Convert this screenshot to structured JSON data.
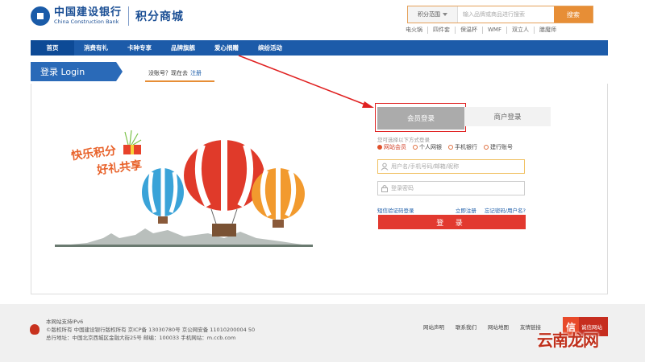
{
  "header": {
    "logo_cn": "中国建设银行",
    "logo_en": "China Construction Bank",
    "mall_title": "积分商城",
    "search": {
      "scope": "积分范围",
      "placeholder": "输入品牌或商品进行搜索",
      "button": "搜索"
    },
    "hot_words": [
      "电火锅",
      "四件套",
      "保温杯",
      "WMF",
      "双立人",
      "膳魔师"
    ]
  },
  "nav": {
    "items": [
      "首页",
      "消费有礼",
      "卡种专享",
      "品牌旗舰",
      "爱心捐赠",
      "缤纷活动"
    ]
  },
  "login_bar": {
    "title": "登录 Login",
    "no_account": "没账号？现在去",
    "register": "注册"
  },
  "illustration": {
    "slogan_line1": "快乐积分",
    "slogan_line2": "好礼共享"
  },
  "login_form": {
    "tab_member": "会员登录",
    "tab_merchant": "商户登录",
    "hint": "您可选择以下方式登录",
    "methods": [
      {
        "label": "网站会员",
        "selected": true
      },
      {
        "label": "个人网银",
        "selected": false
      },
      {
        "label": "手机银行",
        "selected": false
      },
      {
        "label": "建行账号",
        "selected": false
      }
    ],
    "username_placeholder": "用户名/手机号码/邮箱/昵称",
    "password_placeholder": "登录密码",
    "sms_login": "短信验证码登录",
    "register_now": "立即注册",
    "forgot": "忘记密码/用户名?",
    "submit": "登 录"
  },
  "footer": {
    "ipv6": "本网站支持IPv6",
    "copyright": "©版权所有 中国建设银行版权所有 京ICP备 13030780号 京公网安备 11010200004 50",
    "address": "总行地址：中国北京西城区金融大街25号 邮编：100033 手机网站：m.ccb.com",
    "links": [
      "网站声明",
      "联系我们",
      "网站地图",
      "友情链接"
    ],
    "badge_icon": "信",
    "badge_label": "诚信网站",
    "watermark": "云南龙网"
  },
  "colors": {
    "brand_blue": "#1c5ba9",
    "accent_orange": "#e78e36",
    "login_red": "#e2392f",
    "annotation_red": "#e02020"
  }
}
